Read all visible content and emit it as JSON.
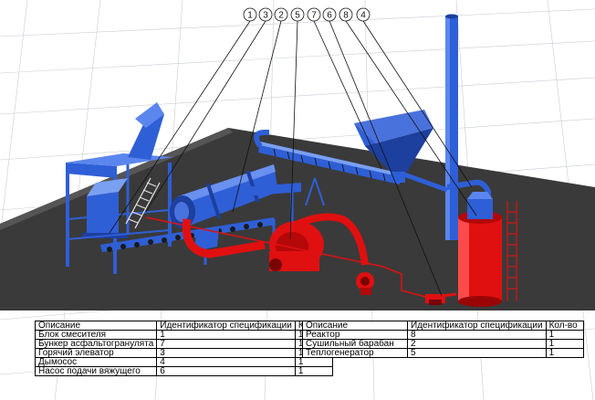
{
  "callouts": [
    "1",
    "3",
    "2",
    "5",
    "7",
    "6",
    "8",
    "4"
  ],
  "colors": {
    "blue_equipment": "#2f5fd6",
    "red_equipment": "#e01010",
    "floor": "#3a3a3a",
    "grid": "#c8ccd4",
    "leader_lines": "#111111"
  },
  "table_left": {
    "headers": [
      "Описание",
      "Идентификатор спецификации",
      "Кол-во"
    ],
    "rows": [
      [
        "Блок смесителя",
        "1",
        "1"
      ],
      [
        "Бункер асфальтогранулята",
        "7",
        "1"
      ],
      [
        "Горячий элеватор",
        "3",
        "1"
      ],
      [
        "Дымосос",
        "4",
        "1"
      ],
      [
        "Насос подачи вяжущего",
        "6",
        "1"
      ]
    ]
  },
  "table_right": {
    "headers": [
      "Описание",
      "Идентификатор спецификации",
      "Кол-во"
    ],
    "rows": [
      [
        "Реактор",
        "8",
        "1"
      ],
      [
        "Сушильный барабан",
        "2",
        "1"
      ],
      [
        "Теплогенератор",
        "5",
        "1"
      ]
    ]
  }
}
